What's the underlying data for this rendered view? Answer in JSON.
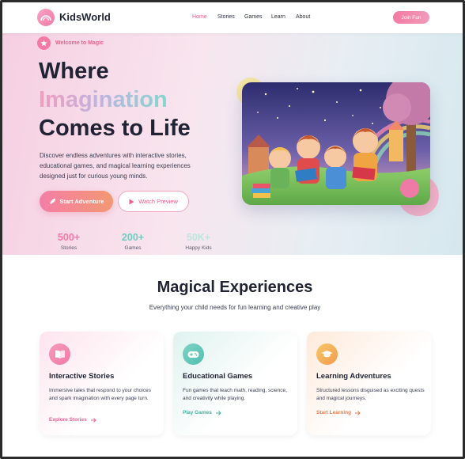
{
  "brand": {
    "name": "KidsWorld"
  },
  "nav": {
    "links": [
      "Home",
      "Stories",
      "Games",
      "Learn",
      "About"
    ],
    "active": "Home",
    "cta": "Join Fun"
  },
  "hero": {
    "badge": "Welcome to Magic",
    "title_line1": "Where",
    "title_line2": "Imagination",
    "title_line3": "Comes to Life",
    "description": "Discover endless adventures with interactive stories, educational games, and magical learning experiences designed just for curious young minds.",
    "primary_button": "Start Adventure",
    "secondary_button": "Watch Preview",
    "stats": [
      {
        "value": "500+",
        "label": "Stories",
        "color": "#f17aa3"
      },
      {
        "value": "200+",
        "label": "Games",
        "color": "#6fcdbf"
      },
      {
        "value": "50K+",
        "label": "Happy Kids",
        "color": "#bde6de"
      }
    ]
  },
  "features": {
    "title": "Magical Experiences",
    "subtitle": "Everything your child needs for fun learning and creative play",
    "cards": [
      {
        "title": "Interactive Stories",
        "description": "Immersive tales that respond to your choices and spark imagination with every page turn.",
        "link": "Explore Stories",
        "icon": "book-icon",
        "accent": "#ef5f8c"
      },
      {
        "title": "Educational Games",
        "description": "Fun games that teach math, reading, science, and creativity while playing.",
        "link": "Play Games",
        "icon": "gamepad-icon",
        "accent": "#3fb3a3"
      },
      {
        "title": "Learning Adventures",
        "description": "Structured lessons disguised as exciting quests and magical journeys.",
        "link": "Start Learning",
        "icon": "graduation-cap-icon",
        "accent": "#f07a3e"
      }
    ]
  },
  "colors": {
    "primary_pink": "#ef5f8c",
    "teal": "#3fb3a3",
    "orange": "#f07a3e",
    "text_dark": "#1f2333"
  }
}
